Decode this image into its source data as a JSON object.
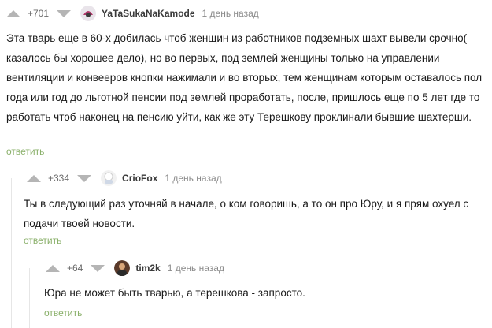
{
  "comments": [
    {
      "rating": "+701",
      "username": "YaTaSukaNaKamode",
      "time": "1 день назад",
      "text": "Эта тварь еще в 60-х добилась чтоб женщин из работников подземных шахт вывели срочно( казалось бы хорошее дело), но во первых, под землей женщины только на управлении вентиляции и конвееров кнопки нажимали и во вторых, тем женщинам которым оставалось пол года или год до льготной пенсии под землей проработать, после, пришлось еще по 5 лет где то работать чтоб наконец на пенсию уйти, как же эту Терешкову проклинали бывшие шахтерши.",
      "reply": "ответить"
    },
    {
      "rating": "+334",
      "username": "CrioFox",
      "time": "1 день назад",
      "text": "Ты в следующий раз уточняй в начале, о ком говоришь, а то он про Юру, и я прям охуел с подачи твоей новости.",
      "reply": "ответить"
    },
    {
      "rating": "+64",
      "username": "tim2k",
      "time": "1 день назад",
      "text": "Юра не может быть тварью, а терешкова - запросто.",
      "reply": "ответить"
    }
  ],
  "icons": {
    "upvote": "upvote-triangle-icon",
    "downvote": "downvote-triangle-icon"
  },
  "colors": {
    "reply_link": "#8ab06a",
    "vote_arrow": "#b5b5b5",
    "thread_line": "#e6e6e6"
  }
}
